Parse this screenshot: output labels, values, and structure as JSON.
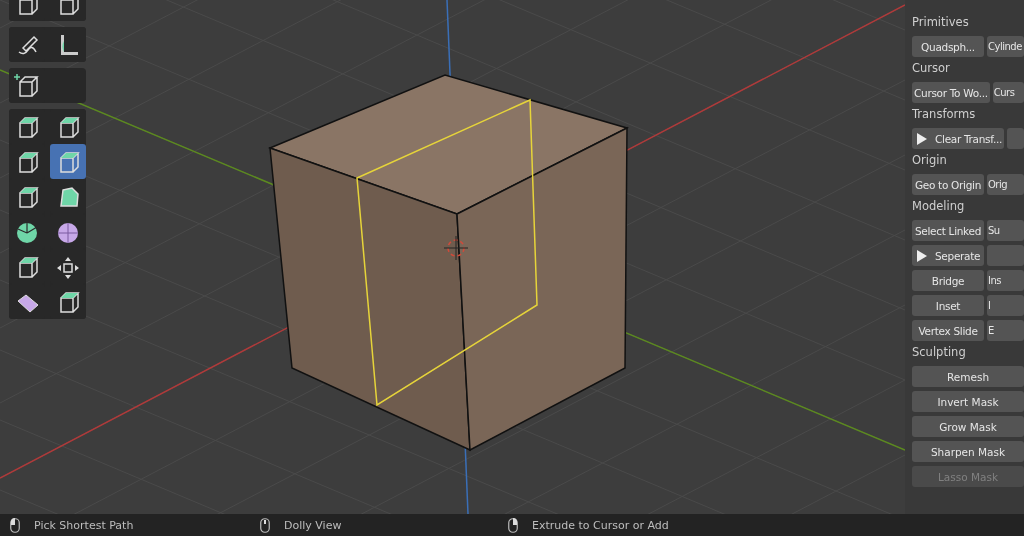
{
  "toolbar": {
    "groups": [
      [
        {
          "selected": false
        },
        {
          "selected": false
        }
      ],
      [
        {
          "selected": false
        },
        {
          "selected": false
        }
      ],
      [
        {
          "selected": false
        }
      ],
      [
        {
          "selected": false
        },
        {
          "selected": false
        },
        {
          "selected": false
        },
        {
          "selected": true
        },
        {
          "selected": false
        },
        {
          "selected": false
        },
        {
          "selected": false
        },
        {
          "selected": false
        },
        {
          "selected": false
        },
        {
          "selected": false
        },
        {
          "selected": false
        },
        {
          "selected": false
        }
      ]
    ]
  },
  "sidebar": {
    "sections": [
      {
        "title": "Primitives",
        "rows": [
          [
            {
              "kind": "text",
              "label": "Quadsph..."
            },
            {
              "kind": "text",
              "label": "Cylinde"
            }
          ]
        ]
      },
      {
        "title": "Cursor",
        "rows": [
          [
            {
              "kind": "text",
              "label": "Cursor To Wo..."
            },
            {
              "kind": "text",
              "label": "Curs"
            }
          ]
        ]
      },
      {
        "title": "Transforms",
        "rows": [
          [
            {
              "kind": "play",
              "label": "Clear Transf..."
            },
            {
              "kind": "blank"
            }
          ]
        ]
      },
      {
        "title": "Origin",
        "rows": [
          [
            {
              "kind": "text",
              "label": "Geo to Origin"
            },
            {
              "kind": "text",
              "label": "Orig"
            }
          ]
        ]
      },
      {
        "title": "Modeling",
        "rows": [
          [
            {
              "kind": "text",
              "label": "Select Linked"
            },
            {
              "kind": "text",
              "label": "Su"
            }
          ],
          [
            {
              "kind": "play",
              "label": "Seperate"
            },
            {
              "kind": "blank"
            }
          ],
          [
            {
              "kind": "text",
              "label": "Bridge"
            },
            {
              "kind": "text",
              "label": "Ins"
            }
          ],
          [
            {
              "kind": "text",
              "label": "Inset"
            },
            {
              "kind": "text",
              "label": "I"
            }
          ],
          [
            {
              "kind": "text",
              "label": "Vertex Slide"
            },
            {
              "kind": "text",
              "label": "E"
            }
          ]
        ]
      },
      {
        "title": "Sculpting",
        "rows": [
          [
            {
              "kind": "text",
              "label": "Remesh",
              "disabled": false
            }
          ],
          [
            {
              "kind": "text",
              "label": "Invert Mask",
              "disabled": false
            }
          ],
          [
            {
              "kind": "text",
              "label": "Grow Mask",
              "disabled": false
            }
          ],
          [
            {
              "kind": "text",
              "label": "Sharpen Mask",
              "disabled": false
            }
          ],
          [
            {
              "kind": "text",
              "label": "Lasso Mask",
              "disabled": true
            }
          ]
        ]
      }
    ]
  },
  "status_bar": {
    "items": [
      {
        "kind": "left",
        "label": "Pick Shortest Path"
      },
      {
        "kind": "middle",
        "label": "Dolly View"
      },
      {
        "kind": "right",
        "label": "Extrude to Cursor or Add"
      }
    ]
  }
}
